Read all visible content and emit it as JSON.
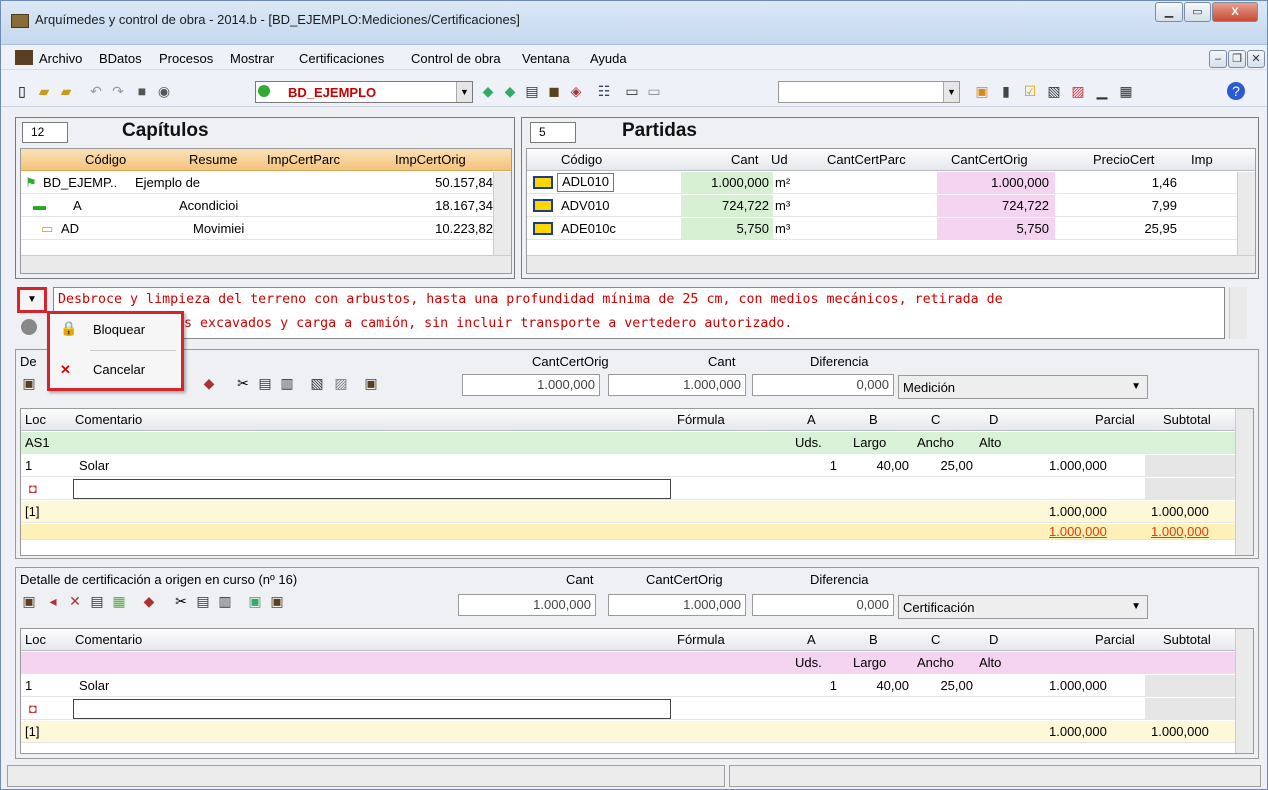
{
  "window": {
    "title": "Arquímedes y control de obra - 2014.b - [BD_EJEMPLO:Mediciones/Certificaciones]"
  },
  "menu": [
    "Archivo",
    "BDatos",
    "Procesos",
    "Mostrar",
    "Certificaciones",
    "Control de obra",
    "Ventana",
    "Ayuda"
  ],
  "toolbar": {
    "db_name": "BD_EJEMPLO"
  },
  "capitulos": {
    "count": "12",
    "title": "Capítulos",
    "columns": [
      "Código",
      "Resume",
      "ImpCertParc",
      "ImpCertOrig"
    ],
    "rows": [
      {
        "code": "BD_EJEMP..",
        "resume": "Ejemplo de",
        "parc": "",
        "orig": "50.157,84"
      },
      {
        "code": "A",
        "resume": "Acondicioi",
        "parc": "",
        "orig": "18.167,34"
      },
      {
        "code": "AD",
        "resume": "Movimiei",
        "parc": "",
        "orig": "10.223,82"
      }
    ]
  },
  "partidas": {
    "count": "5",
    "title": "Partidas",
    "columns": [
      "Código",
      "Cant",
      "Ud",
      "CantCertParc",
      "CantCertOrig",
      "PrecioCert",
      "Imp"
    ],
    "rows": [
      {
        "code": "ADL010",
        "cant": "1.000,000",
        "ud": "m²",
        "parc": "",
        "orig": "1.000,000",
        "precio": "1,46"
      },
      {
        "code": "ADV010",
        "cant": "724,722",
        "ud": "m³",
        "parc": "",
        "orig": "724,722",
        "precio": "7,99"
      },
      {
        "code": "ADE010c",
        "cant": "5,750",
        "ud": "m³",
        "parc": "",
        "orig": "5,750",
        "precio": "25,95"
      }
    ]
  },
  "description": {
    "line1": "Desbroce y limpieza del terreno con arbustos, hasta una profundidad mínima de 25 cm, con medios mecánicos, retirada de",
    "line2": "s excavados y carga a camión, sin incluir transporte a vertedero autorizado."
  },
  "popup": {
    "lock": "Bloquear",
    "cancel": "Cancelar"
  },
  "medicion": {
    "label": "De",
    "h_cantcertorig": "CantCertOrig",
    "h_cant": "Cant",
    "h_diferencia": "Diferencia",
    "v_cantcertorig": "1.000,000",
    "v_cant": "1.000,000",
    "v_diferencia": "0,000",
    "mode": "Medición",
    "columns": [
      "Loc",
      "Comentario",
      "Fórmula",
      "A",
      "B",
      "C",
      "D",
      "Parcial",
      "Subtotal"
    ],
    "header_row": {
      "loc": "AS1",
      "a": "Uds.",
      "b": "Largo",
      "c": "Ancho",
      "d": "Alto"
    },
    "data_row": {
      "loc": "1",
      "comment": "Solar",
      "a": "1",
      "b": "40,00",
      "c": "25,00",
      "parcial": "1.000,000"
    },
    "sum_row": {
      "loc": "[1]",
      "parcial": "1.000,000",
      "subtotal": "1.000,000"
    },
    "total_row": {
      "parcial": "1.000,000",
      "subtotal": "1.000,000"
    }
  },
  "certificacion": {
    "label": "Detalle de certificación a origen en curso (nº 16)",
    "h_cant": "Cant",
    "h_cantcertorig": "CantCertOrig",
    "h_diferencia": "Diferencia",
    "v_cant": "1.000,000",
    "v_cantcertorig": "1.000,000",
    "v_diferencia": "0,000",
    "mode": "Certificación",
    "columns": [
      "Loc",
      "Comentario",
      "Fórmula",
      "A",
      "B",
      "C",
      "D",
      "Parcial",
      "Subtotal"
    ],
    "header_row": {
      "a": "Uds.",
      "b": "Largo",
      "c": "Ancho",
      "d": "Alto"
    },
    "data_row": {
      "loc": "1",
      "comment": "Solar",
      "a": "1",
      "b": "40,00",
      "c": "25,00",
      "parcial": "1.000,000"
    },
    "sum_row": {
      "loc": "[1]",
      "parcial": "1.000,000",
      "subtotal": "1.000,000"
    }
  }
}
